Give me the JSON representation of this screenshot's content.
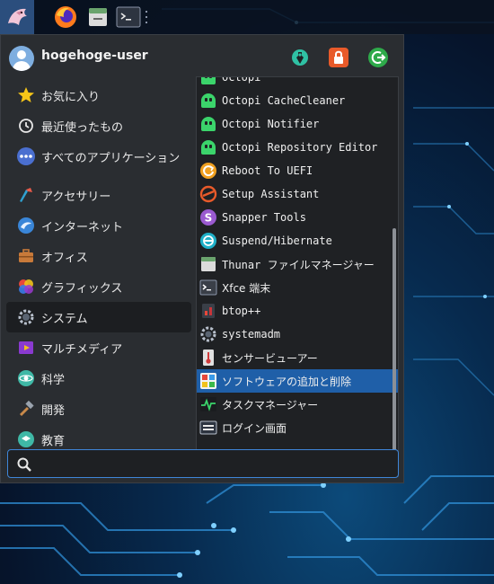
{
  "panel": {
    "items": [
      "whisker-menu",
      "firefox",
      "file-manager",
      "terminal"
    ]
  },
  "menu": {
    "username": "hogehoge-user",
    "header_buttons": [
      "settings-icon",
      "lock-icon",
      "logout-icon"
    ],
    "categories": [
      {
        "label": "お気に入り",
        "icon": "star-icon"
      },
      {
        "label": "最近使ったもの",
        "icon": "clock-icon"
      },
      {
        "label": "すべてのアプリケーション",
        "icon": "dots-icon"
      },
      {
        "label": "アクセサリー",
        "icon": "accessories-icon"
      },
      {
        "label": "インターネット",
        "icon": "internet-icon"
      },
      {
        "label": "オフィス",
        "icon": "briefcase-icon"
      },
      {
        "label": "グラフィックス",
        "icon": "graphics-icon"
      },
      {
        "label": "システム",
        "icon": "gear-icon",
        "selected": true
      },
      {
        "label": "マルチメディア",
        "icon": "multimedia-icon"
      },
      {
        "label": "科学",
        "icon": "science-icon"
      },
      {
        "label": "開発",
        "icon": "hammer-icon"
      },
      {
        "label": "教育",
        "icon": "education-icon"
      }
    ],
    "apps": [
      {
        "label": "Octopi",
        "icon": "octopi-icon"
      },
      {
        "label": "Octopi CacheCleaner",
        "icon": "octopi-icon"
      },
      {
        "label": "Octopi Notifier",
        "icon": "octopi-icon"
      },
      {
        "label": "Octopi Repository Editor",
        "icon": "octopi-icon"
      },
      {
        "label": "Reboot To UEFI",
        "icon": "reboot-icon"
      },
      {
        "label": "Setup Assistant",
        "icon": "setup-icon"
      },
      {
        "label": "Snapper Tools",
        "icon": "snapper-icon"
      },
      {
        "label": "Suspend/Hibernate",
        "icon": "suspend-icon"
      },
      {
        "label": "Thunar ファイルマネージャー",
        "icon": "thunar-icon"
      },
      {
        "label": "Xfce 端末",
        "icon": "terminal-icon"
      },
      {
        "label": "btop++",
        "icon": "btop-icon"
      },
      {
        "label": "systemadm",
        "icon": "systemadm-icon"
      },
      {
        "label": "センサービューアー",
        "icon": "thermometer-icon"
      },
      {
        "label": "ソフトウェアの追加と削除",
        "icon": "software-icon",
        "selected": true
      },
      {
        "label": "タスクマネージャー",
        "icon": "taskmanager-icon"
      },
      {
        "label": "ログイン画面",
        "icon": "login-screen-icon"
      }
    ],
    "search": {
      "value": "",
      "placeholder": ""
    }
  },
  "colors": {
    "menu_bg": "#2a2d31",
    "selection": "#1f5fa8",
    "search_border": "#3f86d9",
    "panel_accent": "#2b4e7d"
  }
}
